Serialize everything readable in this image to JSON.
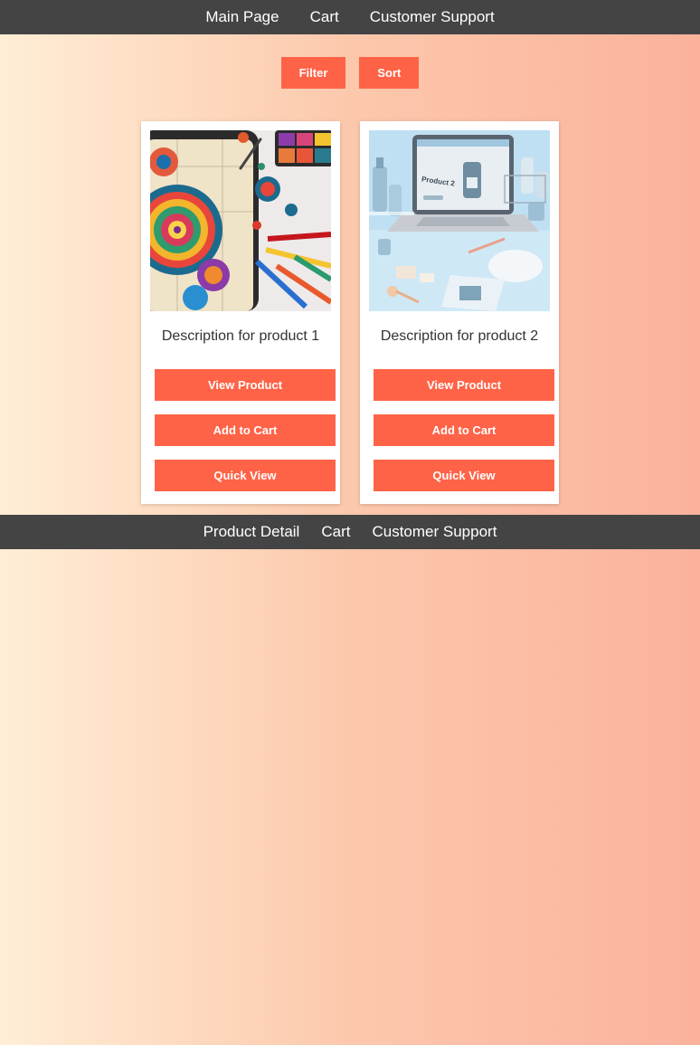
{
  "top_nav": {
    "links": [
      "Main Page",
      "Cart",
      "Customer Support"
    ]
  },
  "controls": {
    "filter_label": "Filter",
    "sort_label": "Sort"
  },
  "products": [
    {
      "image_label": "",
      "description": "Description for product 1",
      "view_label": "View Product",
      "cart_label": "Add to Cart",
      "quick_label": "Quick View"
    },
    {
      "image_label": "Product 2",
      "description": "Description for product 2",
      "view_label": "View Product",
      "cart_label": "Add to Cart",
      "quick_label": "Quick View"
    }
  ],
  "bottom_nav": {
    "links": [
      "Product Detail",
      "Cart",
      "Customer Support"
    ]
  },
  "colors": {
    "accent": "#ff6347",
    "nav_bg": "#444444"
  }
}
